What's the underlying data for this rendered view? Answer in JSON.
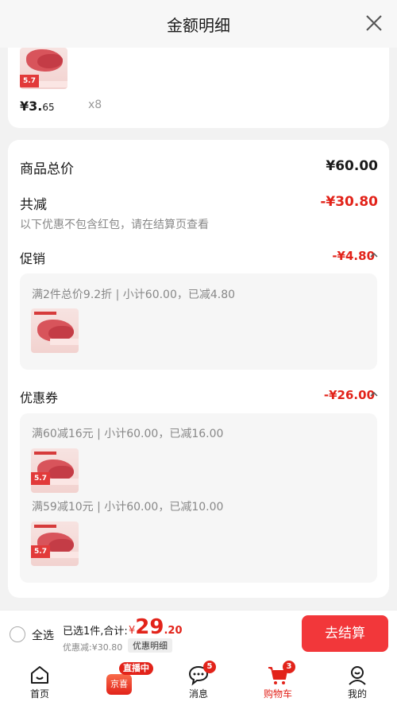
{
  "header": {
    "title": "金额明细"
  },
  "product_card": {
    "price_int": "¥3.",
    "price_dec": "65",
    "quantity": "x8",
    "thumb_tag": "5.7"
  },
  "summary": {
    "total_label": "商品总价",
    "total_value": "¥60.00",
    "reduce_label": "共减",
    "reduce_value": "-¥30.80",
    "note": "以下优惠不包含红包，请在结算页查看"
  },
  "promotion": {
    "label": "促销",
    "value": "-¥4.80",
    "rule": "满2件总价9.2折 | 小计60.00，已减4.80",
    "thumb_title": "大片猪肉"
  },
  "coupon": {
    "label": "优惠券",
    "value": "-¥26.00",
    "rules": [
      {
        "text": "满60减16元 | 小计60.00，已减16.00",
        "thumb_title": "大片猪肉",
        "thumb_tag": "5.7"
      },
      {
        "text": "满59减10元 | 小计60.00，已减10.00",
        "thumb_title": "大片猪肉",
        "thumb_tag": "5.7"
      }
    ]
  },
  "bottom_bar": {
    "select_all": "全选",
    "selected_text": "已选1件,合计:",
    "yen": "¥",
    "total_int": "29",
    "total_dec": ".20",
    "discount_text": "优惠减:¥30.80",
    "detail_button": "优惠明细",
    "checkout_button": "去结算"
  },
  "nav": {
    "home": "首页",
    "live_badge": "直播中",
    "jingxi": "京喜",
    "messages": "消息",
    "messages_badge": "5",
    "cart": "购物车",
    "cart_badge": "3",
    "mine": "我的"
  },
  "colors": {
    "accent": "#e2231a",
    "checkout": "#f2373a"
  }
}
